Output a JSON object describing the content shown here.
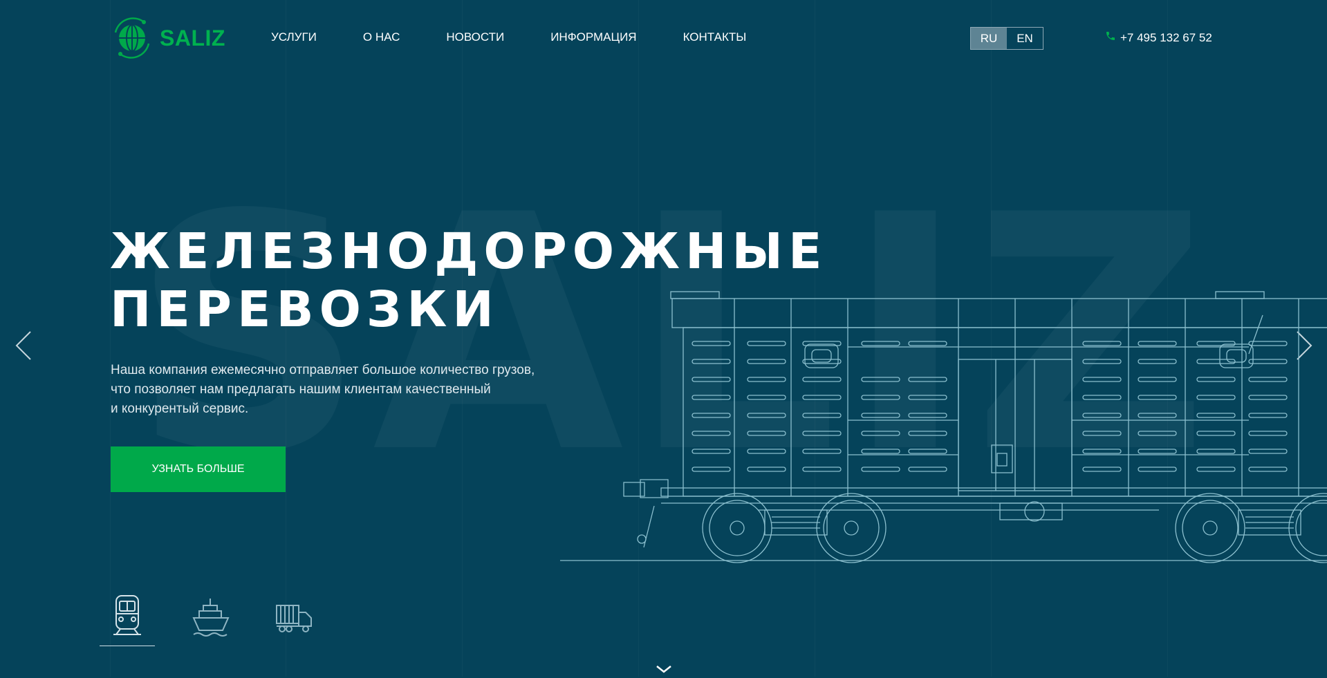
{
  "brand": {
    "name": "SALIZ",
    "logo_icon": "globe-icon",
    "color": "#00b14f"
  },
  "nav": {
    "items": [
      {
        "label": "УСЛУГИ"
      },
      {
        "label": "О НАС"
      },
      {
        "label": "НОВОСТИ"
      },
      {
        "label": "ИНФОРМАЦИЯ"
      },
      {
        "label": "КОНТАКТЫ"
      }
    ]
  },
  "language": {
    "options": [
      "RU",
      "EN"
    ],
    "selected": "RU"
  },
  "contact": {
    "phone": "+7 495 132 67 52",
    "icon": "phone-icon"
  },
  "hero": {
    "watermark": "SALIZ",
    "title_lines": [
      "ЖЕЛЕЗНОДОРОЖНЫЕ",
      "ПЕРЕВОЗКИ"
    ],
    "description_lines": [
      "Наша компания ежемесячно отправляет большое количество грузов,",
      "что позволяет нам предлагать нашим клиентам качественный",
      "и конкурентый сервис."
    ],
    "cta_label": "УЗНАТЬ БОЛЬШЕ",
    "image": "railway-wagon-illustration",
    "prev_icon": "chevron-left-icon",
    "next_icon": "chevron-right-icon"
  },
  "transport_types": [
    {
      "icon": "train-icon",
      "active": true
    },
    {
      "icon": "ship-icon",
      "active": false
    },
    {
      "icon": "truck-icon",
      "active": false
    }
  ],
  "scroll_icon": "chevron-down-icon",
  "colors": {
    "background": "#05435a",
    "accent": "#00a94a",
    "lang_active": "#5e8494"
  }
}
